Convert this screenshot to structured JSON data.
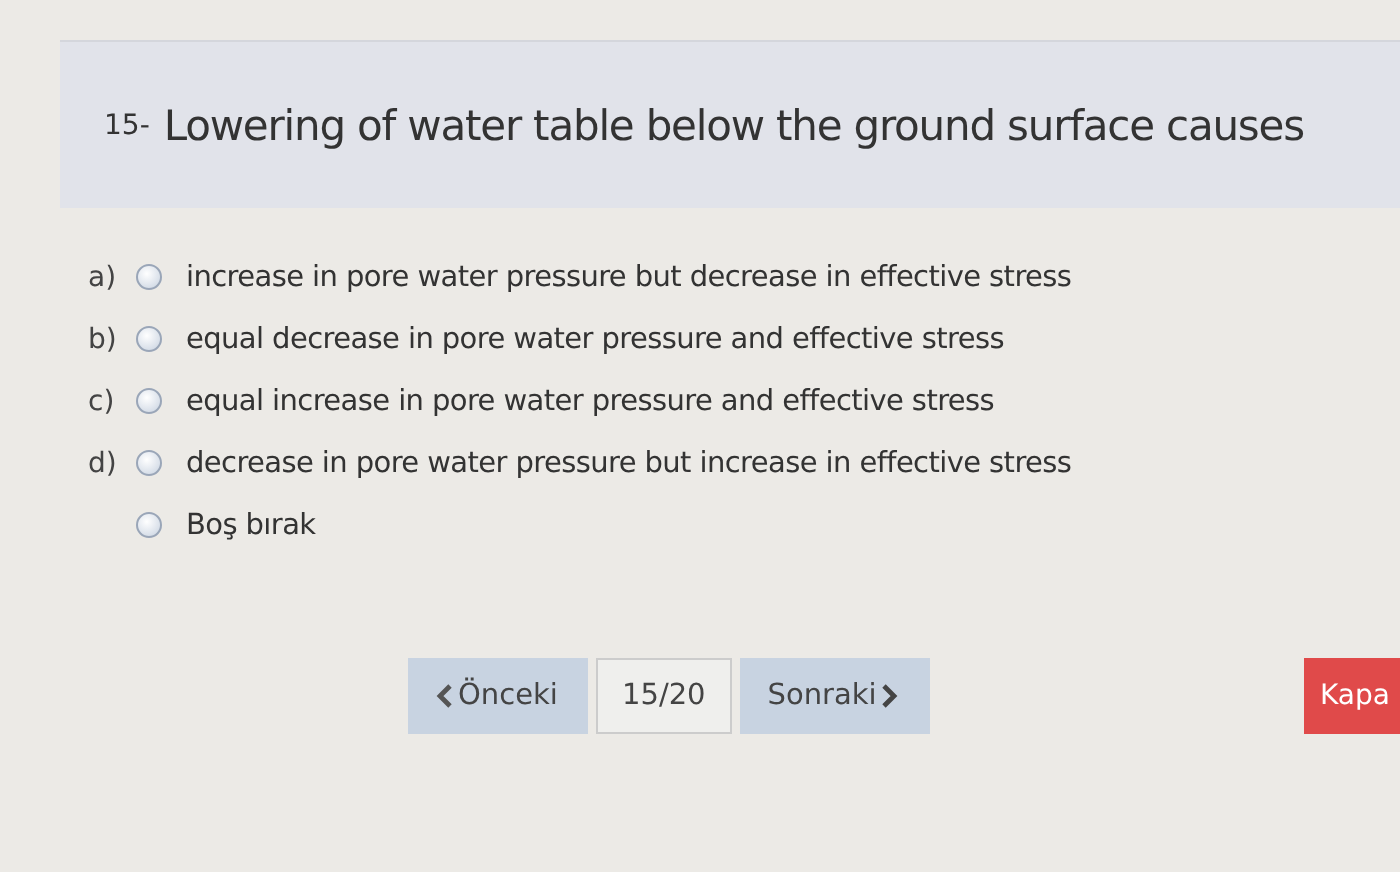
{
  "question": {
    "number": "15-",
    "text": "Lowering  of water table below the ground surface causes"
  },
  "options": [
    {
      "letter": "a)",
      "text": "increase in pore water pressure but decrease in effective stress",
      "selected": false
    },
    {
      "letter": "b)",
      "text": "equal decrease in pore water pressure and effective stress",
      "selected": false
    },
    {
      "letter": "c)",
      "text": "equal increase in pore water pressure and effective stress",
      "selected": false
    },
    {
      "letter": "d)",
      "text": "decrease in pore water pressure but increase in effective stress",
      "selected": false
    },
    {
      "text": "Boş bırak",
      "selected": false
    }
  ],
  "nav": {
    "previous": "Önceki",
    "counter": "15/20",
    "next": "Sonraki",
    "close": "Kapa"
  }
}
